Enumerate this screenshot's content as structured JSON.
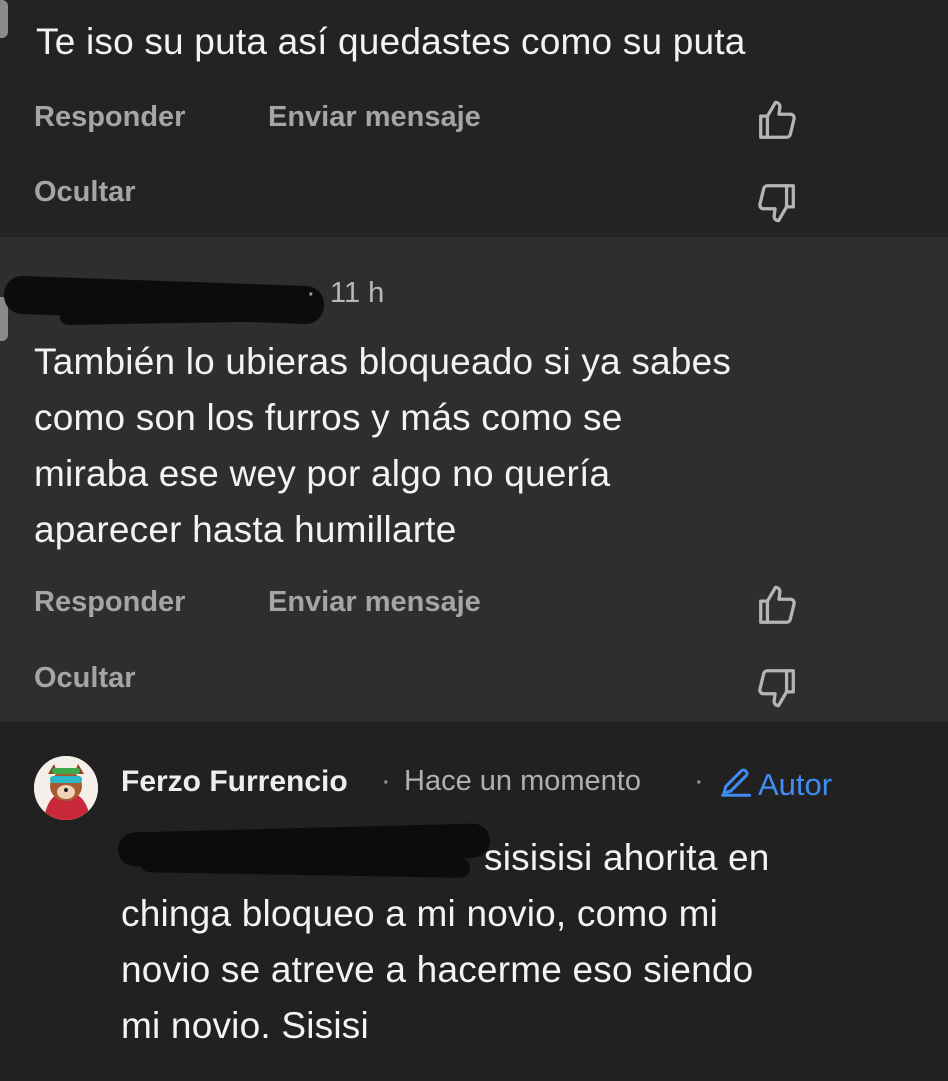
{
  "comments": [
    {
      "text_lines": [
        "Te iso su puta así quedastes como su puta"
      ],
      "actions": {
        "reply": "Responder",
        "message": "Enviar mensaje",
        "hide": "Ocultar"
      }
    },
    {
      "time": "11 h",
      "text_lines": [
        "También lo ubieras bloqueado si ya sabes",
        "como son los furros  y más como se",
        "miraba ese wey por algo no quería",
        "aparecer hasta humillarte"
      ],
      "actions": {
        "reply": "Responder",
        "message": "Enviar mensaje",
        "hide": "Ocultar"
      }
    },
    {
      "author": "Ferzo Furrencio",
      "time": "Hace un momento",
      "author_badge": "Autor",
      "text_lines": [
        "sisisisi ahorita en",
        "chinga bloqueo a mi novio, como mi",
        "novio se atreve a hacerme eso siendo",
        "mi novio. Sisisi"
      ]
    }
  ],
  "separator": "·",
  "icons": {
    "like": "thumbs-up-icon",
    "dislike": "thumbs-down-icon",
    "author": "pencil-icon"
  },
  "colors": {
    "background": "#212121",
    "highlight_background": "#2e2e2e",
    "action_text": "#a5a5a5",
    "author_badge": "#3f8cf3"
  }
}
